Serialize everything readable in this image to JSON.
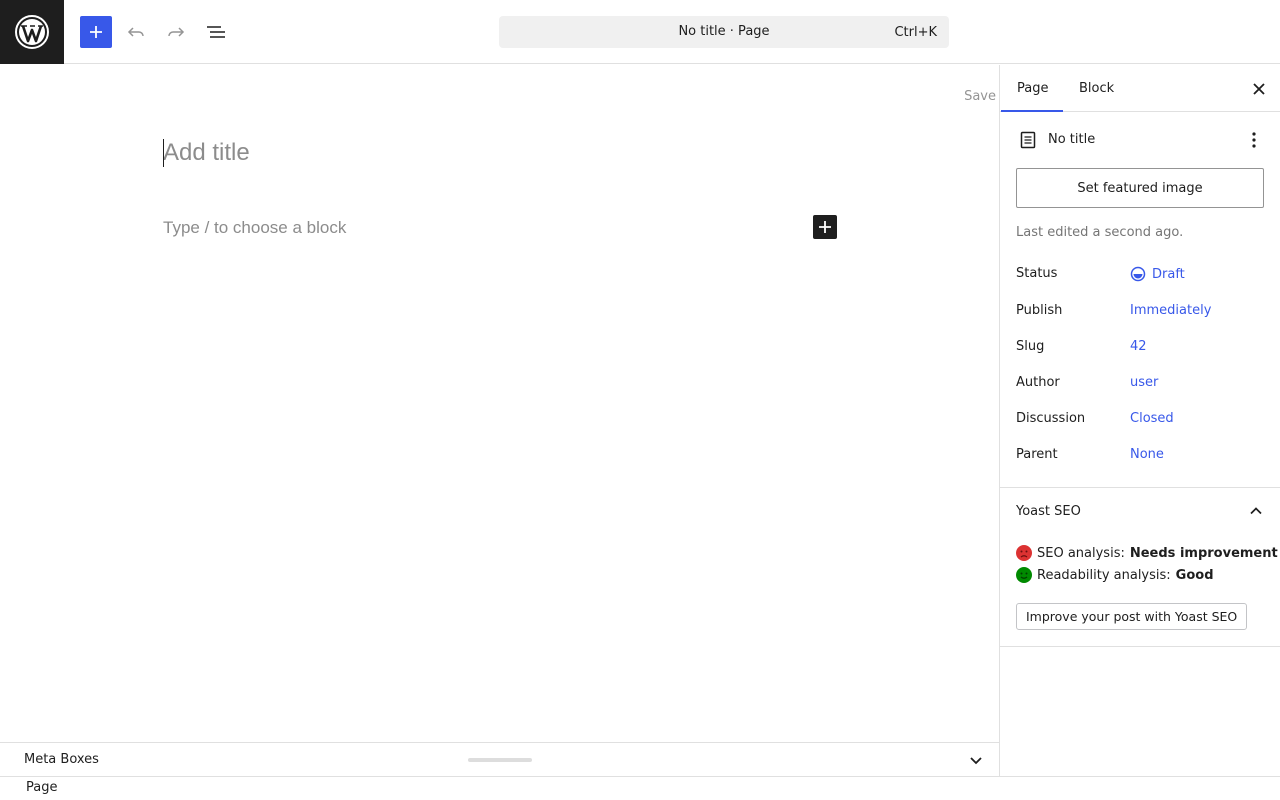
{
  "topbar": {
    "command": {
      "title": "No title · Page",
      "shortcut": "Ctrl+K"
    }
  },
  "editor": {
    "save_label": "Save",
    "title_placeholder": "Add title",
    "block_placeholder": "Type / to choose a block"
  },
  "metabox": {
    "label": "Meta Boxes"
  },
  "footer": {
    "breadcrumb": "Page"
  },
  "sidebar": {
    "tabs": [
      {
        "label": "Page",
        "active": true
      },
      {
        "label": "Block",
        "active": false
      }
    ],
    "doc_title": "No title",
    "featured_button": "Set featured image",
    "last_edited": "Last edited a second ago.",
    "props": [
      {
        "key": "Status",
        "value": "Draft"
      },
      {
        "key": "Publish",
        "value": "Immediately"
      },
      {
        "key": "Slug",
        "value": "42"
      },
      {
        "key": "Author",
        "value": "user"
      },
      {
        "key": "Discussion",
        "value": "Closed"
      },
      {
        "key": "Parent",
        "value": "None"
      }
    ],
    "yoast": {
      "header": "Yoast SEO",
      "seo_label": "SEO analysis:",
      "seo_value": "Needs improvement",
      "read_label": "Readability analysis:",
      "read_value": "Good",
      "improve_button": "Improve your post with Yoast SEO"
    }
  },
  "colors": {
    "accent": "#3858e9",
    "seo_bad": "#dc3232",
    "seo_good": "#008a00"
  }
}
